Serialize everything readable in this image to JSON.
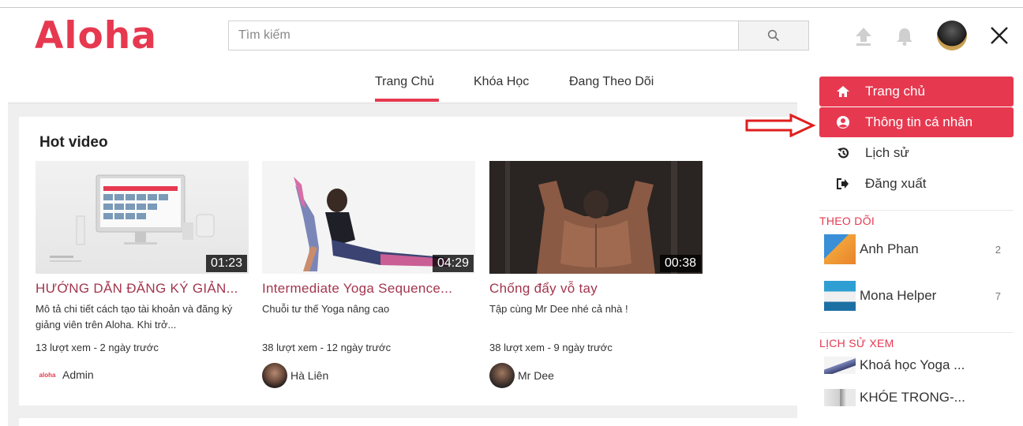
{
  "header": {
    "logo": "Aloha",
    "search_placeholder": "Tìm kiếm",
    "icons": [
      "upload-icon",
      "bell-icon",
      "close-icon"
    ],
    "close_label": "✕"
  },
  "tabs": [
    {
      "label": "Trang Chủ",
      "active": true
    },
    {
      "label": "Khóa Học",
      "active": false
    },
    {
      "label": "Đang Theo Dõi",
      "active": false
    }
  ],
  "hot": {
    "title": "Hot video",
    "videos": [
      {
        "duration": "01:23",
        "title": "HƯỚNG DẪN ĐĂNG KÝ GIẢN...",
        "desc": "Mô tả chi tiết cách tạo tài khoản và đăng ký giảng viên trên Aloha. Khi trở...",
        "meta": "13 lượt xem - 2 ngày trước",
        "author": "Admin"
      },
      {
        "duration": "04:29",
        "title": "Intermediate Yoga Sequence...",
        "desc": "Chuỗi tư thế Yoga nâng cao",
        "meta": "38 lượt xem - 12 ngày trước",
        "author": "Hà Liên"
      },
      {
        "duration": "00:38",
        "title": "Chống đẩy vỗ tay",
        "desc": "Tập cùng Mr Dee nhé cả nhà !",
        "meta": "38 lượt xem - 9 ngày trước",
        "author": "Mr Dee"
      }
    ]
  },
  "sidebar": {
    "menu": [
      {
        "label": "Trang chủ",
        "icon": "home-icon",
        "active": true
      },
      {
        "label": "Thông tin cá nhân",
        "icon": "user-circle-icon",
        "active": true
      },
      {
        "label": "Lịch sử",
        "icon": "history-icon",
        "active": false
      },
      {
        "label": "Đăng xuất",
        "icon": "sign-out-icon",
        "active": false
      }
    ],
    "following_title": "THEO DÕI",
    "following": [
      {
        "name": "Anh Phan",
        "count": "2"
      },
      {
        "name": "Mona Helper",
        "count": "7"
      }
    ],
    "history_title": "LỊCH SỬ XEM",
    "history": [
      {
        "label": "Khoá học Yoga ..."
      },
      {
        "label": "KHÓE TRONG-..."
      }
    ]
  },
  "colors": {
    "accent": "#e63950",
    "title": "#a3354d"
  }
}
